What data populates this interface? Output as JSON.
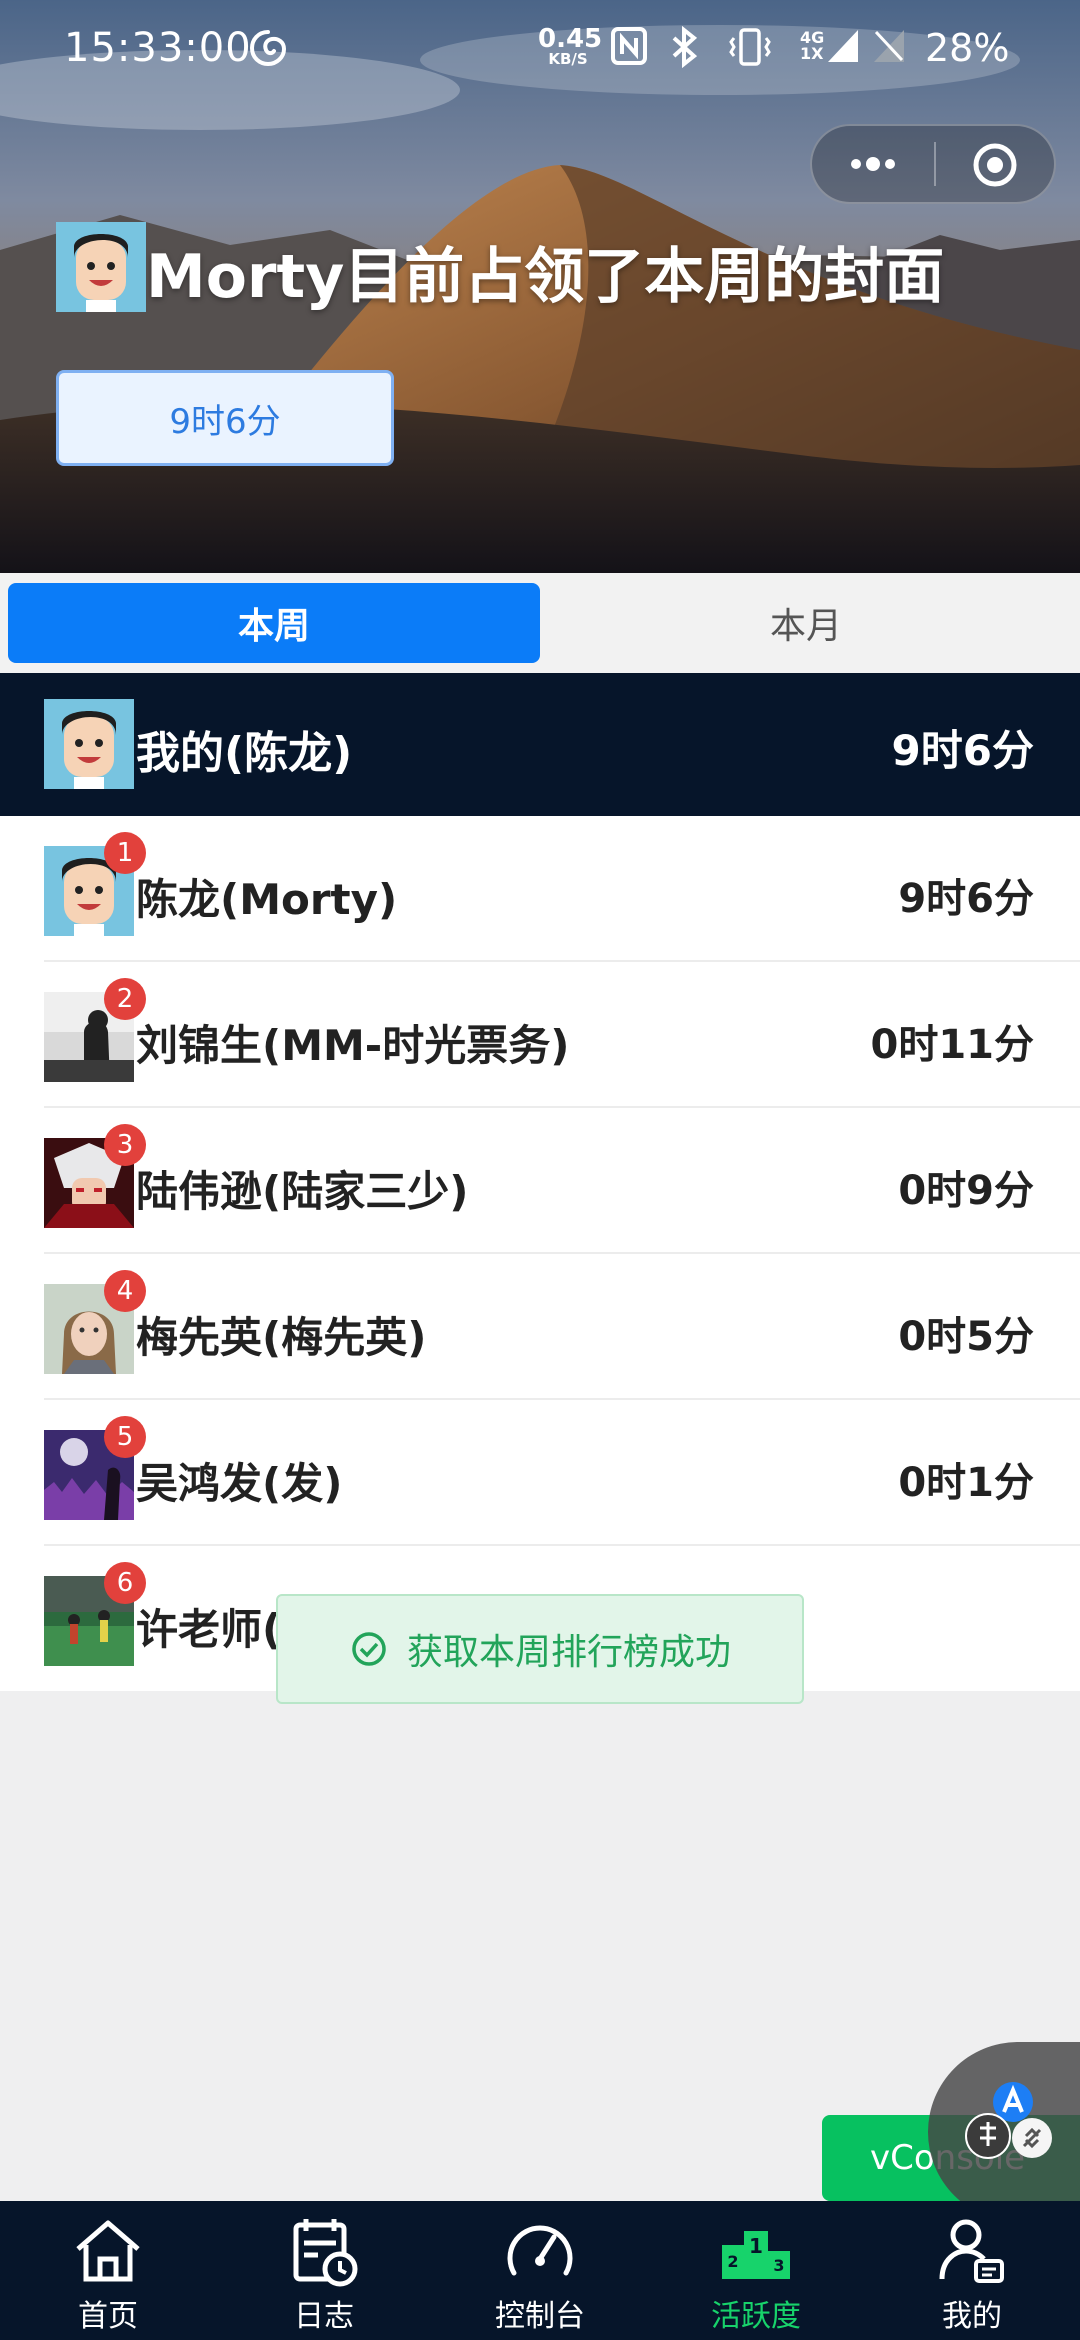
{
  "status_bar": {
    "time": "15:33:00",
    "net_speed_value": "0.45",
    "net_speed_unit": "KB/S",
    "network_label_top": "4G",
    "network_label_bottom": "1X",
    "battery": "28%"
  },
  "cover": {
    "title": "Morty目前占领了本周的封面",
    "time_label": "9时6分"
  },
  "tabs": [
    {
      "label": "本周",
      "active": true
    },
    {
      "label": "本月",
      "active": false
    }
  ],
  "mine": {
    "name": "我的(陈龙)",
    "time": "9时6分"
  },
  "ranking": [
    {
      "rank": "1",
      "name": "陈龙(Morty)",
      "time": "9时6分"
    },
    {
      "rank": "2",
      "name": "刘锦生(MM-时光票务)",
      "time": "0时11分"
    },
    {
      "rank": "3",
      "name": "陆伟逊(陆家三少)",
      "time": "0时9分"
    },
    {
      "rank": "4",
      "name": "梅先英(梅先英)",
      "time": "0时5分"
    },
    {
      "rank": "5",
      "name": "吴鸿发(发)",
      "time": "0时1分"
    },
    {
      "rank": "6",
      "name": "许老师(",
      "time": ""
    }
  ],
  "toast": {
    "message": "获取本周排行榜成功",
    "color": "#22a45a"
  },
  "vconsole_label": "vConsole",
  "bottom_nav": [
    {
      "label": "首页",
      "icon": "home-icon",
      "active": false
    },
    {
      "label": "日志",
      "icon": "log-calendar-icon",
      "active": false
    },
    {
      "label": "控制台",
      "icon": "dashboard-gauge-icon",
      "active": false
    },
    {
      "label": "活跃度",
      "icon": "podium-icon",
      "active": true
    },
    {
      "label": "我的",
      "icon": "profile-icon",
      "active": false
    }
  ],
  "colors": {
    "accent_blue": "#0b7cf8",
    "dark_navy": "#06152a",
    "active_green": "#17d36b",
    "badge_red": "#e2413c"
  }
}
